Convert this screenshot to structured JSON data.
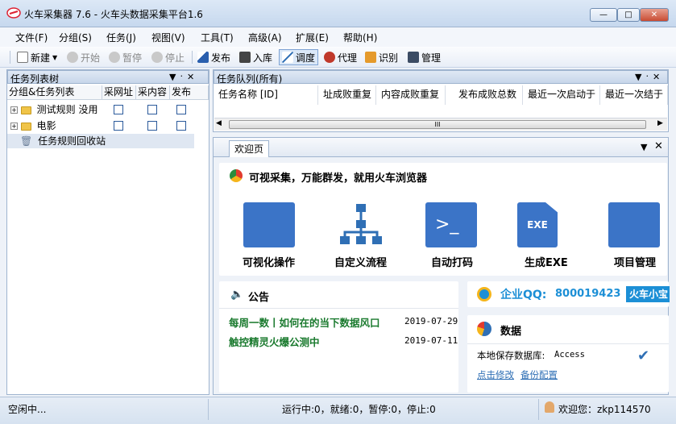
{
  "window": {
    "title": "火车采集器 7.6 - 火车头数据采集平台1.6",
    "min": "—",
    "max": "□",
    "close": "✕"
  },
  "menu": [
    "文件(F)",
    "分组(S)",
    "任务(J)",
    "视图(V)",
    "工具(T)",
    "高级(A)",
    "扩展(E)",
    "帮助(H)"
  ],
  "toolbar": {
    "new": "新建",
    "start": "开始",
    "pause": "暂停",
    "stop": "停止",
    "publish": "发布",
    "import": "入库",
    "schedule": "调度",
    "proxy": "代理",
    "recognize": "识别",
    "manage": "管理"
  },
  "tooltip": "调度",
  "left_panel": {
    "title": "任务列表树",
    "pin": "▼ ᛫ ✕",
    "columns": [
      "分组&任务列表",
      "采网址",
      "采内容",
      "发布"
    ],
    "rows": [
      {
        "label": "测试规则 没用"
      },
      {
        "label": "电影"
      },
      {
        "label": "任务规则回收站"
      }
    ]
  },
  "queue": {
    "title": "任务队列(所有)",
    "columns": [
      "任务名称 [ID]",
      "址成败重复",
      "内容成败重复",
      "发布成败总数",
      "最近一次启动于",
      "最近一次结于"
    ],
    "scroll_mid": "III"
  },
  "welcome": {
    "tab": "欢迎页",
    "headline": "可视采集，万能群发，就用火车浏览器",
    "features": [
      "可视化操作",
      "自定义流程",
      "自动打码",
      "生成EXE",
      "项目管理"
    ],
    "notice_title": "公告",
    "notices": [
      {
        "text": "每周一数丨如何在的当下数据风口",
        "date": "2019-07-29"
      },
      {
        "text": "触控精灵火爆公测中",
        "date": "2019-07-11"
      }
    ],
    "qq_label": "企业QQ:",
    "qq_number": "800019423",
    "qq_button": "火车小宝",
    "data_title": "数据",
    "db_label": "本地保存数据库:",
    "db_value": "Access",
    "db_modify": "点击修改",
    "db_backup": "备份配置"
  },
  "status": {
    "left": "空闲中...",
    "mid": "运行中:0，就绪:0，暂停:0，停止:0",
    "user": "欢迎您：zkp114570"
  },
  "colors": {
    "accent": "#2f6fb5",
    "green": "#1a7a2e",
    "qq_blue": "#1c8fd6"
  }
}
